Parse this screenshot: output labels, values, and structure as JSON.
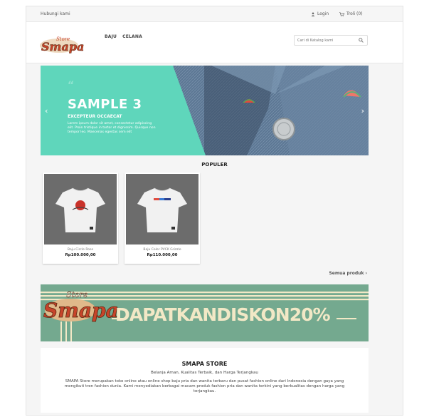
{
  "topbar": {
    "contact": "Hubungi kami",
    "login": "Login",
    "cart": "Troli (0)"
  },
  "header": {
    "logo_script_top": "Store",
    "logo_script_main": "Smapa",
    "nav": [
      "BAJU",
      "CELANA"
    ],
    "search_placeholder": "Cari di Katalog kami"
  },
  "slider": {
    "title": "SAMPLE 3",
    "subtitle": "EXCEPTEUR OCCAECAT",
    "text": "Lorem ipsum dolor sit amet, consectetur adipiscing elit. Proin tristique in tortor et dignissim. Quisque non tempor leo. Maecenas egestas sem elit",
    "quote_mark": "“",
    "prev": "‹",
    "next": "›"
  },
  "populer": {
    "title": "POPULER",
    "products": [
      {
        "name": "Baju Circle Rose",
        "price": "Rp100.000,00"
      },
      {
        "name": "Baju Color PVCK Grizzle",
        "price": "Rp110.000,00"
      }
    ],
    "all_products": "Semua produk ›"
  },
  "promo": {
    "logo_script_top": "Store",
    "logo_script_main": "Smapa",
    "text": "DAPATKANDISKON20%"
  },
  "store": {
    "title": "SMAPA STORE",
    "tagline": "Belanja Aman, Kualitas Terbaik, dan Harga Terjangkau",
    "description": "SMAPA Store merupakan toko online atau online shop baju pria dan wanita terbaru dan pusat fashion online dari Indonesia dengan gaya yang mengikuti tren fashion dunia. Kami menyediakan berbagai macam produk fashion pria dan wanita terkini yang berkualitas dengan harga yang terjangkau."
  },
  "colors": {
    "teal": "#5fd6bb",
    "promo_green": "#74a98f",
    "logo_red": "#c7442a",
    "cream": "#f2e8c6"
  }
}
